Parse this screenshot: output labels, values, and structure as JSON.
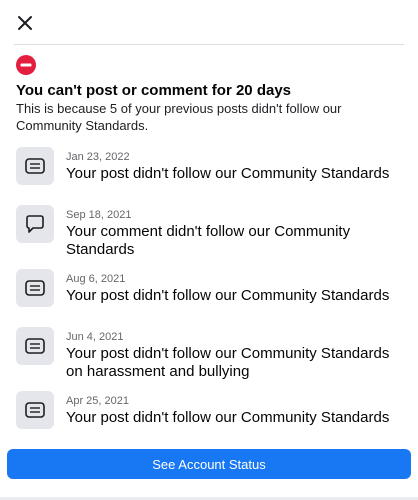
{
  "dialog": {
    "close_icon": "close-icon",
    "status_icon": "restriction-icon",
    "status_color": "#e41e3f",
    "headline": "You can't post or comment for 20 days",
    "subtext": "This is because 5 of your previous posts didn't follow our Community Standards."
  },
  "violations": [
    {
      "icon": "post-icon",
      "date": "Jan 23, 2022",
      "message": "Your post didn't follow our Community Standards"
    },
    {
      "icon": "comment-icon",
      "date": "Sep 18, 2021",
      "message": "Your comment didn't follow our Community Standards"
    },
    {
      "icon": "post-icon",
      "date": "Aug 6, 2021",
      "message": "Your post didn't follow our Community Standards"
    },
    {
      "icon": "post-icon",
      "date": "Jun 4, 2021",
      "message": "Your post didn't follow our Community Standards on harassment and bullying"
    },
    {
      "icon": "post-icon",
      "date": "Apr 25, 2021",
      "message": "Your post didn't follow our Community Standards"
    }
  ],
  "actions": {
    "see_status_label": "See Account Status",
    "accent_color": "#1877f2"
  }
}
